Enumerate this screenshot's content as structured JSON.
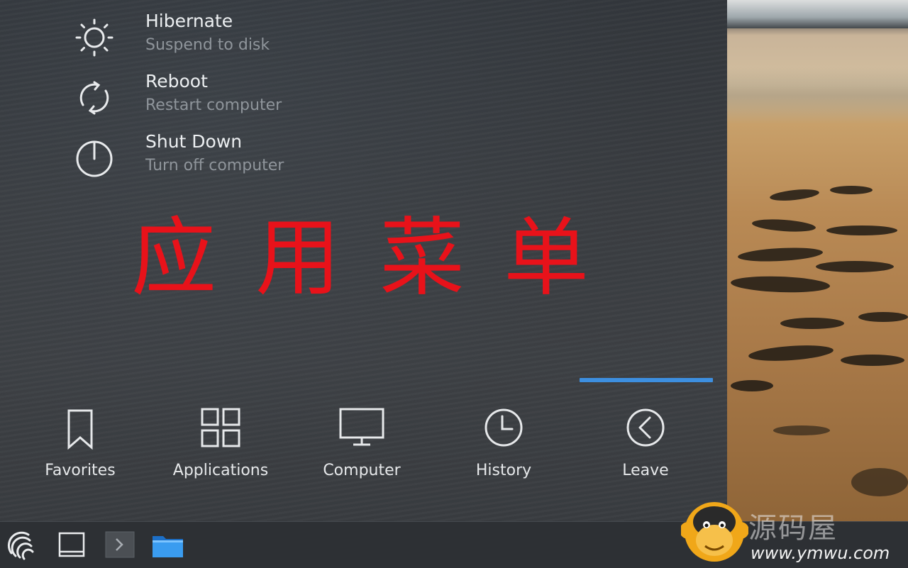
{
  "power_actions": [
    {
      "title": "Hibernate",
      "subtitle": "Suspend to disk",
      "icon": "sun-icon"
    },
    {
      "title": "Reboot",
      "subtitle": "Restart computer",
      "icon": "reboot-icon"
    },
    {
      "title": "Shut Down",
      "subtitle": "Turn off computer",
      "icon": "power-icon"
    }
  ],
  "overlay_title": "应用菜单",
  "tabs": [
    {
      "label": "Favorites",
      "icon": "bookmark-icon",
      "active": false
    },
    {
      "label": "Applications",
      "icon": "grid-icon",
      "active": false
    },
    {
      "label": "Computer",
      "icon": "monitor-icon",
      "active": false
    },
    {
      "label": "History",
      "icon": "clock-icon",
      "active": false
    },
    {
      "label": "Leave",
      "icon": "back-arrow-icon",
      "active": true
    }
  ],
  "taskbar": {
    "items": [
      "launcher-icon",
      "desktop-icon",
      "terminal-icon",
      "folder-icon"
    ]
  },
  "watermark": {
    "site_name": "源码屋",
    "url": "www.ymwu.com"
  },
  "colors": {
    "accent": "#3d8fe0",
    "overlay_text": "#e8121a",
    "panel": "#3a3d41"
  }
}
